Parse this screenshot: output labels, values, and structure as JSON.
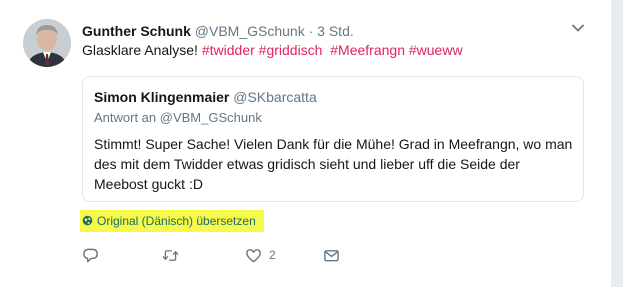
{
  "tweet": {
    "author_name": "Gunther Schunk",
    "author_handle": "@VBM_GSchunk",
    "separator": "·",
    "time": "3 Std.",
    "text": "Glasklare Analyse!",
    "hashtags": [
      "#twidder",
      "#griddisch",
      "#Meefrangn",
      "#wueww"
    ]
  },
  "quoted": {
    "author_name": "Simon Klingenmaier",
    "author_handle": "@SKbarcatta",
    "reply_to": "Antwort an @VBM_GSchunk",
    "text": "Stimmt! Super Sache! Vielen Dank für die Mühe! Grad in Meefrangn, wo man des mit dem Twidder etwas gridisch sieht und lieber uff die Seide der Meebost guckt :D"
  },
  "translate_link": "Original (Dänisch) übersetzen",
  "actions": {
    "reply_count": "",
    "retweet_count": "",
    "like_count": "2"
  },
  "colors": {
    "hashtag": "#e0245e",
    "highlight": "#f6f84a",
    "muted": "#657786"
  },
  "icons": [
    "avatar-photo",
    "chevron-down-icon",
    "globe-icon",
    "reply-icon",
    "retweet-icon",
    "like-icon",
    "message-icon"
  ]
}
